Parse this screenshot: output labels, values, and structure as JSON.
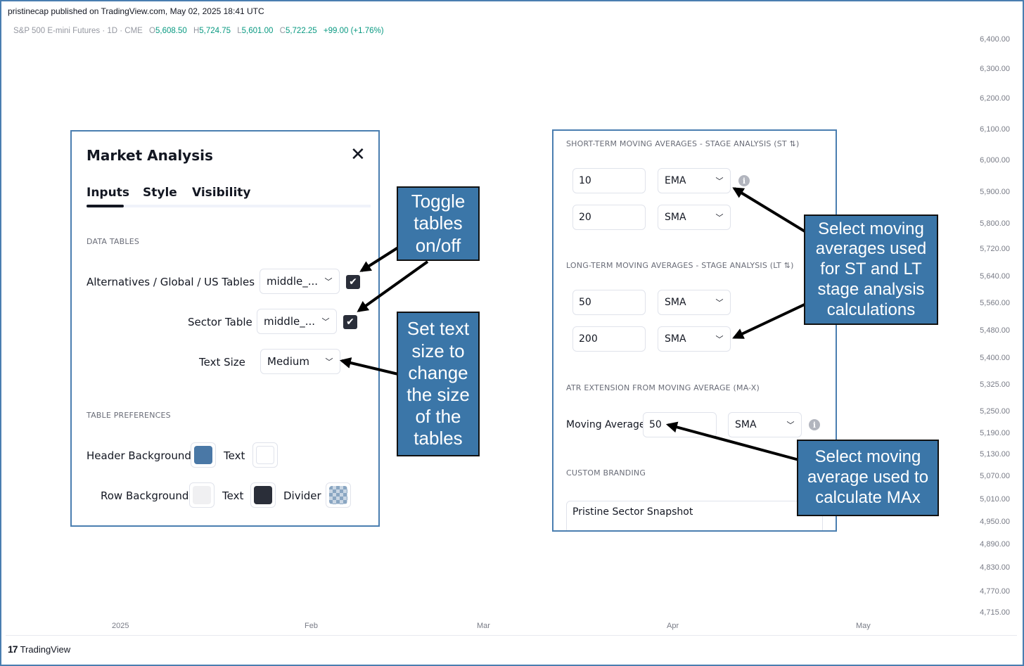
{
  "header": {
    "published": "pristinecap published on TradingView.com, May 02, 2025 18:41 UTC"
  },
  "legend": {
    "symbol": "S&P 500 E-mini Futures · 1D · CME",
    "o_label": "O",
    "o_value": "5,608.50",
    "h_label": "H",
    "h_value": "5,724.75",
    "l_label": "L",
    "l_value": "5,601.00",
    "c_label": "C",
    "c_value": "5,722.25",
    "change": "+99.00 (+1.76%)"
  },
  "price_axis": [
    "6,400.00",
    "6,300.00",
    "6,200.00",
    "6,100.00",
    "6,000.00",
    "5,900.00",
    "5,800.00",
    "5,720.00",
    "5,640.00",
    "5,560.00",
    "5,480.00",
    "5,400.00",
    "5,325.00",
    "5,250.00",
    "5,190.00",
    "5,130.00",
    "5,070.00",
    "5,010.00",
    "4,950.00",
    "4,890.00",
    "4,830.00",
    "4,770.00",
    "4,715.00"
  ],
  "time_axis": [
    "2025",
    "Feb",
    "Mar",
    "Apr",
    "May"
  ],
  "footer": {
    "brand": "TradingView",
    "logo": "17"
  },
  "dialog": {
    "title": "Market Analysis",
    "tabs": [
      {
        "label": "Inputs",
        "active": true
      },
      {
        "label": "Style",
        "active": false
      },
      {
        "label": "Visibility",
        "active": false
      }
    ],
    "data_tables_header": "DATA TABLES",
    "rows": {
      "alt_global_us": {
        "label": "Alternatives / Global / US Tables",
        "value": "middle_...",
        "checked": true
      },
      "sector_table": {
        "label": "Sector Table",
        "value": "middle_...",
        "checked": true
      },
      "text_size": {
        "label": "Text Size",
        "value": "Medium"
      }
    },
    "table_prefs_header": "TABLE PREFERENCES",
    "header_background_label": "Header Background",
    "header_text_label": "Text",
    "row_background_label": "Row Background",
    "row_text_label": "Text",
    "divider_label": "Divider",
    "colors": {
      "header_bg": "#4a78a6",
      "header_text": "#ffffff",
      "row_bg": "#f0f0f2",
      "row_text": "#2a2e39"
    }
  },
  "panel": {
    "st_header": "SHORT-TERM MOVING AVERAGES - STAGE ANALYSIS (ST ⇅)",
    "st_rows": [
      {
        "length": "10",
        "type": "EMA"
      },
      {
        "length": "20",
        "type": "SMA"
      }
    ],
    "lt_header": "LONG-TERM MOVING AVERAGES - STAGE ANALYSIS (LT ⇅)",
    "lt_rows": [
      {
        "length": "50",
        "type": "SMA"
      },
      {
        "length": "200",
        "type": "SMA"
      }
    ],
    "atr_header": "ATR EXTENSION FROM MOVING AVERAGE (MA-X)",
    "atr_label": "Moving Average",
    "atr_length": "50",
    "atr_type": "SMA",
    "branding_header": "CUSTOM BRANDING",
    "branding_value": "Pristine Sector Snapshot"
  },
  "callouts": {
    "toggle": "Toggle tables on/off",
    "text_size": "Set text size to change the size of the tables",
    "select_ma": "Select moving averages used for ST and LT stage analysis calculations",
    "select_max": "Select moving average used to calculate MAx"
  }
}
